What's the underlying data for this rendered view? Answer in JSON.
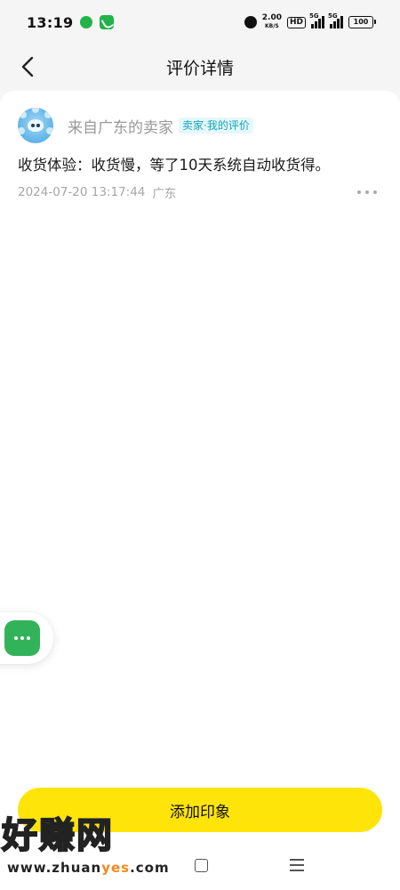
{
  "status_bar": {
    "time": "13:19",
    "speed_value": "2.00",
    "speed_unit": "KB/S",
    "hd": "HD",
    "network1": "5G",
    "network2": "5G",
    "battery": "100"
  },
  "header": {
    "title": "评价详情"
  },
  "review": {
    "seller": "来自广东的卖家",
    "badge": "卖家·我的评价",
    "text": "收货体验：收货慢，等了10天系统自动收货得。",
    "datetime": "2024-07-20 13:17:44",
    "location": "广东"
  },
  "actions": {
    "add_impression": "添加印象"
  },
  "watermark": {
    "big_text": "好赚网",
    "url_prefix": "www.zhuan",
    "url_highlight": "yes",
    "url_suffix": ".com"
  },
  "colors": {
    "accent_yellow": "#ffe40a",
    "badge_teal": "#0fa5b8",
    "chat_green": "#32b35a"
  }
}
